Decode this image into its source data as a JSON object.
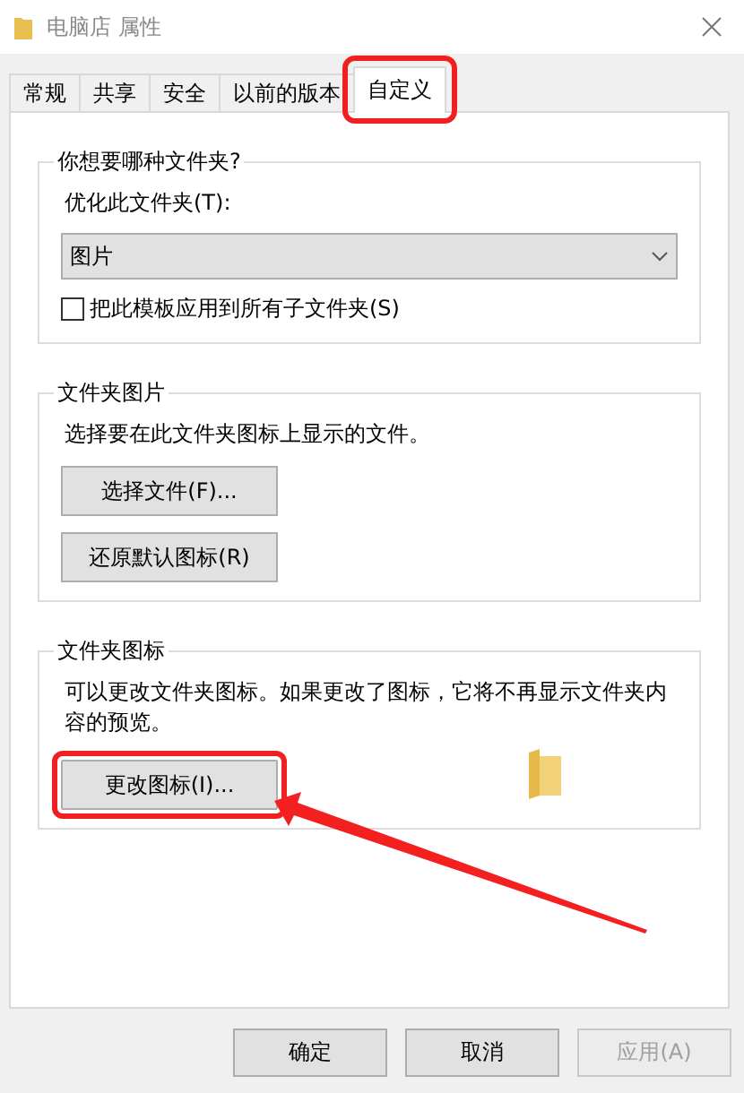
{
  "window": {
    "title": "电脑店 属性"
  },
  "tabs": [
    {
      "label": "常规",
      "selected": false,
      "highlighted": false
    },
    {
      "label": "共享",
      "selected": false,
      "highlighted": false
    },
    {
      "label": "安全",
      "selected": false,
      "highlighted": false
    },
    {
      "label": "以前的版本",
      "selected": false,
      "highlighted": false
    },
    {
      "label": "自定义",
      "selected": true,
      "highlighted": true
    }
  ],
  "template": {
    "title": "你想要哪种文件夹?",
    "label": "优化此文件夹(T):",
    "dropdown": {
      "value": "图片"
    },
    "checkbox": {
      "label": "把此模板应用到所有子文件夹(S)",
      "checked": false
    }
  },
  "folder_pictures": {
    "title": "文件夹图片",
    "description": "选择要在此文件夹图标上显示的文件。",
    "buttons": [
      {
        "label": "选择文件(F)..."
      },
      {
        "label": "还原默认图标(R)"
      }
    ]
  },
  "folder_icons": {
    "title": "文件夹图标",
    "description": "可以更改文件夹图标。如果更改了图标，它将不再显示文件夹内容的预览。",
    "button": {
      "label": "更改图标(I)...",
      "highlighted": true
    }
  },
  "callout_arrow": true,
  "dialog_buttons": [
    {
      "label": "确定",
      "disabled": false
    },
    {
      "label": "取消",
      "disabled": false
    },
    {
      "label": "应用(A)",
      "disabled": true
    }
  ]
}
